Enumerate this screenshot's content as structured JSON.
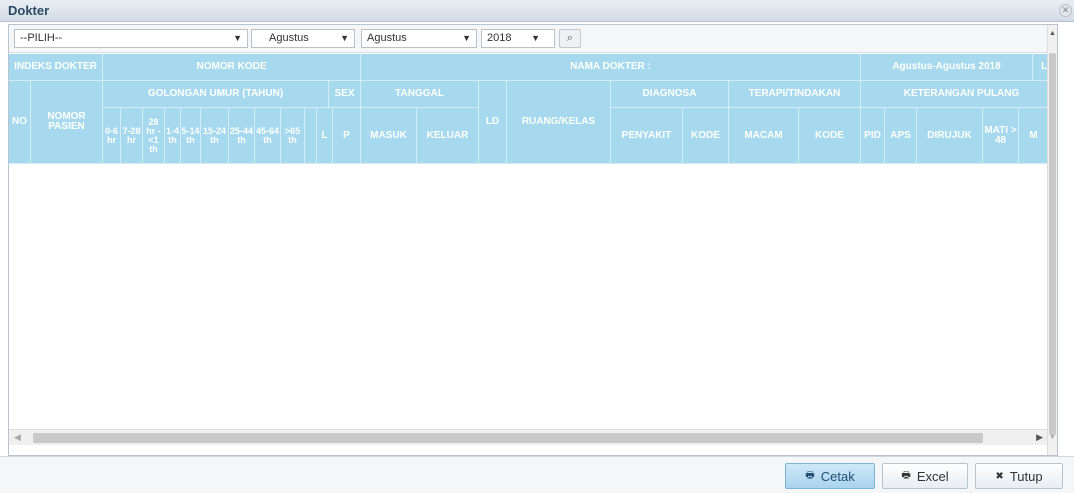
{
  "window": {
    "title": "Dokter",
    "close_icon": "close-icon"
  },
  "filters": {
    "dokter_select": "--PILIH--",
    "bulan_awal": "Agustus",
    "bulan_akhir": "Agustus",
    "tahun": "2018",
    "search_icon": "search-icon"
  },
  "header": {
    "indeks_dokter": "INDEKS DOKTER",
    "nomor_kode": "NOMOR KODE",
    "nama_dokter": "NAMA DOKTER :",
    "periode": "Agustus-Agustus 2018",
    "le": "LE",
    "golongan_umur": "GOLONGAN UMUR (TAHUN)",
    "sex": "SEX",
    "tanggal": "TANGGAL",
    "no": "NO",
    "nomor_pasien": "NOMOR PASIEN",
    "ld": "LD",
    "ruang_kelas": "RUANG/KELAS",
    "diagnosa": "DIAGNOSA",
    "terapi_tindakan": "TERAPI/TINDAKAN",
    "keterangan_pulang": "KETERANGAN PULANG",
    "umur_cols": [
      "0-6 hr",
      "7-28 hr",
      "28 hr - <1 th",
      "1-4 th",
      "5-14 th",
      "15-24 th",
      "25-44 th",
      "45-64 th",
      ">65 th"
    ],
    "sex_l": "L",
    "sex_p": "P",
    "masuk": "MASUK",
    "keluar": "KELUAR",
    "penyakit": "PENYAKIT",
    "kode_diag": "KODE",
    "macam": "MACAM",
    "kode_terapi": "KODE",
    "pid": "PID",
    "aps": "APS",
    "dirujuk": "DIRUJUK",
    "mati_48": "MATI > 48",
    "m": "M"
  },
  "rows": [],
  "footer": {
    "cetak": "Cetak",
    "excel": "Excel",
    "tutup": "Tutup"
  }
}
